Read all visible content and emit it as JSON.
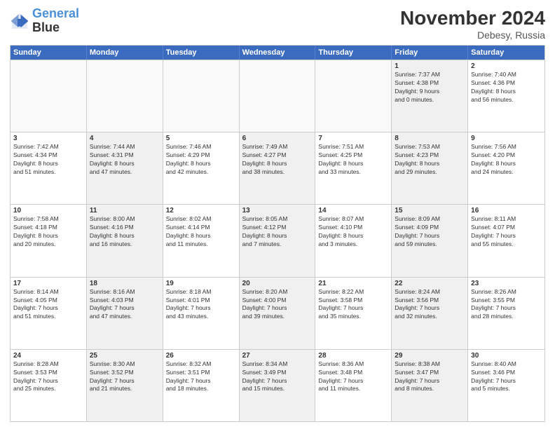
{
  "logo": {
    "line1": "General",
    "line2": "Blue"
  },
  "title": "November 2024",
  "location": "Debesy, Russia",
  "weekdays": [
    "Sunday",
    "Monday",
    "Tuesday",
    "Wednesday",
    "Thursday",
    "Friday",
    "Saturday"
  ],
  "rows": [
    [
      {
        "day": "",
        "detail": "",
        "empty": true
      },
      {
        "day": "",
        "detail": "",
        "empty": true
      },
      {
        "day": "",
        "detail": "",
        "empty": true
      },
      {
        "day": "",
        "detail": "",
        "empty": true
      },
      {
        "day": "",
        "detail": "",
        "empty": true
      },
      {
        "day": "1",
        "detail": "Sunrise: 7:37 AM\nSunset: 4:38 PM\nDaylight: 9 hours\nand 0 minutes.",
        "empty": false,
        "shaded": true
      },
      {
        "day": "2",
        "detail": "Sunrise: 7:40 AM\nSunset: 4:36 PM\nDaylight: 8 hours\nand 56 minutes.",
        "empty": false,
        "shaded": false
      }
    ],
    [
      {
        "day": "3",
        "detail": "Sunrise: 7:42 AM\nSunset: 4:34 PM\nDaylight: 8 hours\nand 51 minutes.",
        "empty": false,
        "shaded": false
      },
      {
        "day": "4",
        "detail": "Sunrise: 7:44 AM\nSunset: 4:31 PM\nDaylight: 8 hours\nand 47 minutes.",
        "empty": false,
        "shaded": true
      },
      {
        "day": "5",
        "detail": "Sunrise: 7:46 AM\nSunset: 4:29 PM\nDaylight: 8 hours\nand 42 minutes.",
        "empty": false,
        "shaded": false
      },
      {
        "day": "6",
        "detail": "Sunrise: 7:49 AM\nSunset: 4:27 PM\nDaylight: 8 hours\nand 38 minutes.",
        "empty": false,
        "shaded": true
      },
      {
        "day": "7",
        "detail": "Sunrise: 7:51 AM\nSunset: 4:25 PM\nDaylight: 8 hours\nand 33 minutes.",
        "empty": false,
        "shaded": false
      },
      {
        "day": "8",
        "detail": "Sunrise: 7:53 AM\nSunset: 4:23 PM\nDaylight: 8 hours\nand 29 minutes.",
        "empty": false,
        "shaded": true
      },
      {
        "day": "9",
        "detail": "Sunrise: 7:56 AM\nSunset: 4:20 PM\nDaylight: 8 hours\nand 24 minutes.",
        "empty": false,
        "shaded": false
      }
    ],
    [
      {
        "day": "10",
        "detail": "Sunrise: 7:58 AM\nSunset: 4:18 PM\nDaylight: 8 hours\nand 20 minutes.",
        "empty": false,
        "shaded": false
      },
      {
        "day": "11",
        "detail": "Sunrise: 8:00 AM\nSunset: 4:16 PM\nDaylight: 8 hours\nand 16 minutes.",
        "empty": false,
        "shaded": true
      },
      {
        "day": "12",
        "detail": "Sunrise: 8:02 AM\nSunset: 4:14 PM\nDaylight: 8 hours\nand 11 minutes.",
        "empty": false,
        "shaded": false
      },
      {
        "day": "13",
        "detail": "Sunrise: 8:05 AM\nSunset: 4:12 PM\nDaylight: 8 hours\nand 7 minutes.",
        "empty": false,
        "shaded": true
      },
      {
        "day": "14",
        "detail": "Sunrise: 8:07 AM\nSunset: 4:10 PM\nDaylight: 8 hours\nand 3 minutes.",
        "empty": false,
        "shaded": false
      },
      {
        "day": "15",
        "detail": "Sunrise: 8:09 AM\nSunset: 4:09 PM\nDaylight: 7 hours\nand 59 minutes.",
        "empty": false,
        "shaded": true
      },
      {
        "day": "16",
        "detail": "Sunrise: 8:11 AM\nSunset: 4:07 PM\nDaylight: 7 hours\nand 55 minutes.",
        "empty": false,
        "shaded": false
      }
    ],
    [
      {
        "day": "17",
        "detail": "Sunrise: 8:14 AM\nSunset: 4:05 PM\nDaylight: 7 hours\nand 51 minutes.",
        "empty": false,
        "shaded": false
      },
      {
        "day": "18",
        "detail": "Sunrise: 8:16 AM\nSunset: 4:03 PM\nDaylight: 7 hours\nand 47 minutes.",
        "empty": false,
        "shaded": true
      },
      {
        "day": "19",
        "detail": "Sunrise: 8:18 AM\nSunset: 4:01 PM\nDaylight: 7 hours\nand 43 minutes.",
        "empty": false,
        "shaded": false
      },
      {
        "day": "20",
        "detail": "Sunrise: 8:20 AM\nSunset: 4:00 PM\nDaylight: 7 hours\nand 39 minutes.",
        "empty": false,
        "shaded": true
      },
      {
        "day": "21",
        "detail": "Sunrise: 8:22 AM\nSunset: 3:58 PM\nDaylight: 7 hours\nand 35 minutes.",
        "empty": false,
        "shaded": false
      },
      {
        "day": "22",
        "detail": "Sunrise: 8:24 AM\nSunset: 3:56 PM\nDaylight: 7 hours\nand 32 minutes.",
        "empty": false,
        "shaded": true
      },
      {
        "day": "23",
        "detail": "Sunrise: 8:26 AM\nSunset: 3:55 PM\nDaylight: 7 hours\nand 28 minutes.",
        "empty": false,
        "shaded": false
      }
    ],
    [
      {
        "day": "24",
        "detail": "Sunrise: 8:28 AM\nSunset: 3:53 PM\nDaylight: 7 hours\nand 25 minutes.",
        "empty": false,
        "shaded": false
      },
      {
        "day": "25",
        "detail": "Sunrise: 8:30 AM\nSunset: 3:52 PM\nDaylight: 7 hours\nand 21 minutes.",
        "empty": false,
        "shaded": true
      },
      {
        "day": "26",
        "detail": "Sunrise: 8:32 AM\nSunset: 3:51 PM\nDaylight: 7 hours\nand 18 minutes.",
        "empty": false,
        "shaded": false
      },
      {
        "day": "27",
        "detail": "Sunrise: 8:34 AM\nSunset: 3:49 PM\nDaylight: 7 hours\nand 15 minutes.",
        "empty": false,
        "shaded": true
      },
      {
        "day": "28",
        "detail": "Sunrise: 8:36 AM\nSunset: 3:48 PM\nDaylight: 7 hours\nand 11 minutes.",
        "empty": false,
        "shaded": false
      },
      {
        "day": "29",
        "detail": "Sunrise: 8:38 AM\nSunset: 3:47 PM\nDaylight: 7 hours\nand 8 minutes.",
        "empty": false,
        "shaded": true
      },
      {
        "day": "30",
        "detail": "Sunrise: 8:40 AM\nSunset: 3:46 PM\nDaylight: 7 hours\nand 5 minutes.",
        "empty": false,
        "shaded": false
      }
    ]
  ]
}
